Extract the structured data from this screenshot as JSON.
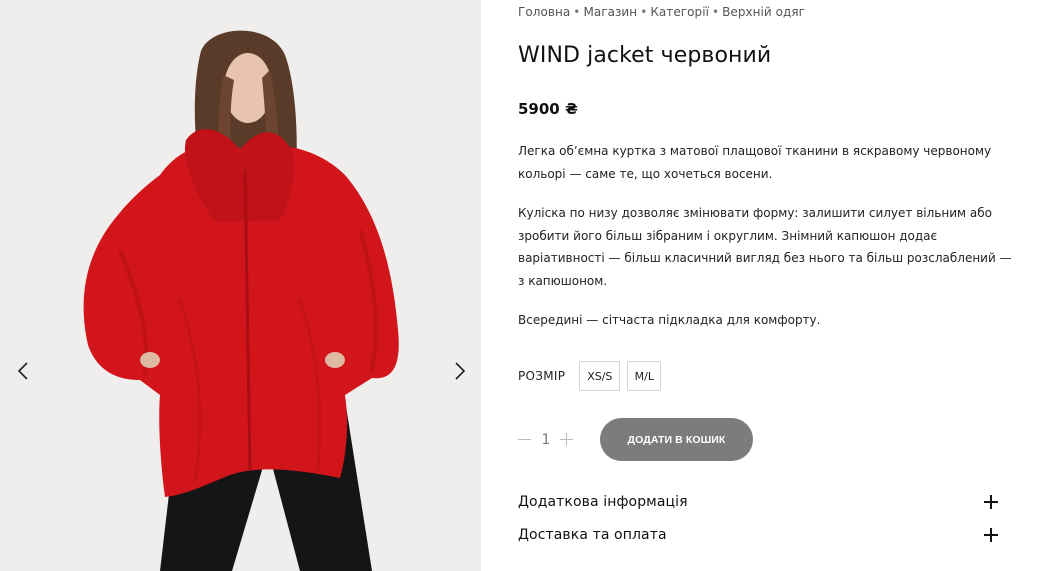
{
  "breadcrumb": {
    "items": [
      "Головна",
      "Магазин",
      "Категорії",
      "Верхній одяг"
    ],
    "separator": "•"
  },
  "product": {
    "title": "WIND jacket червоний",
    "price": "5900 ₴",
    "description": [
      "Легка об’ємна куртка з матової плащової тканини в яскравому червоному кольорі — саме те, що хочеться восени.",
      "Куліска по низу дозволяє змінювати форму: залишити силует вільним або зробити його більш зібраним і округлим. Знімний капюшон додає варіативності — більш класичний вигляд без нього та більш розслаблений — з капюшоном.",
      "Всередині — сітчаста підкладка для комфорту."
    ]
  },
  "size": {
    "label": "РОЗМІР",
    "options": [
      "XS/S",
      "M/L"
    ]
  },
  "quantity": {
    "value": "1"
  },
  "cart": {
    "add_label": "ДОДАТИ В КОШИК"
  },
  "accordion": [
    {
      "label": "Додаткова інформація"
    },
    {
      "label": "Доставка та оплата"
    }
  ],
  "gallery": {
    "prev_icon": "chevron-left-icon",
    "next_icon": "chevron-right-icon"
  },
  "colors": {
    "jacket_red": "#d2141b",
    "button_grey": "#7c7c7c",
    "photo_bg": "#efeeec"
  }
}
